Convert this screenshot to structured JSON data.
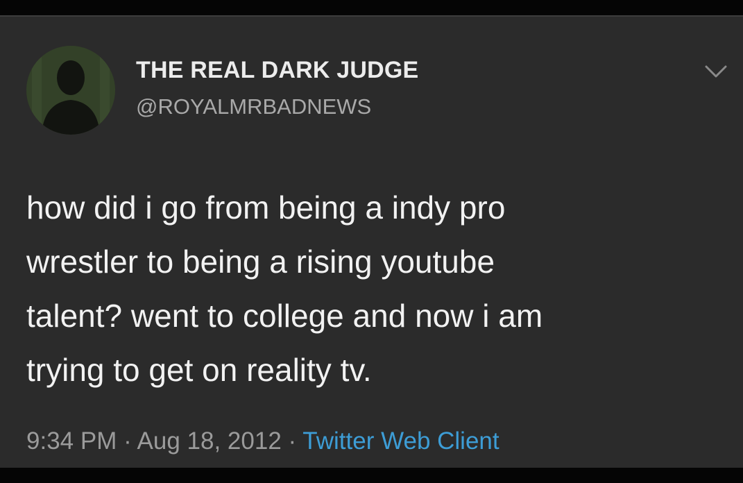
{
  "tweet": {
    "author": {
      "display_name": "THE REAL DARK JUDGE",
      "handle": "@ROYALMRBADNEWS",
      "avatar_icon": "silhouette-avatar"
    },
    "menu_icon": "chevron-down-icon",
    "text": "how did i go from being a indy pro\nwrestler to being a rising youtube\ntalent? went to college and now i am\ntrying to get on reality tv.",
    "time": "9:34 PM",
    "separator": "·",
    "date": "Aug 18, 2012",
    "source": "Twitter Web Client"
  },
  "colors": {
    "card_background": "#2b2b2b",
    "frame": "#000000",
    "link": "#3d9dd6",
    "primary_text": "#f2f2f2",
    "secondary_text": "#9b9b9b"
  }
}
